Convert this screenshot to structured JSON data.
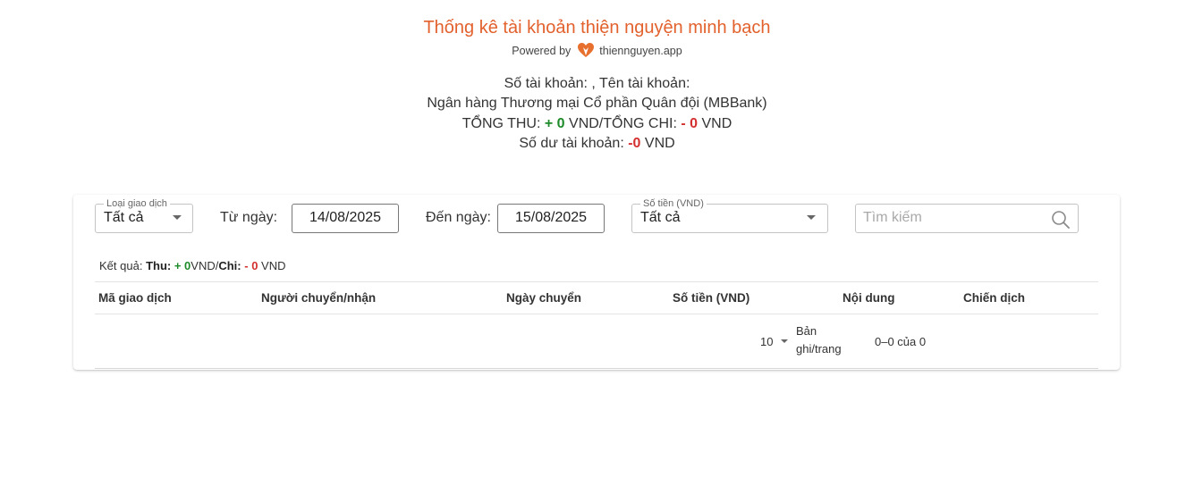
{
  "header": {
    "title": "Thống kê tài khoản thiện nguyện minh bạch",
    "powered_by": "Powered by",
    "brand": "thiennguyen.app",
    "account_line": "Số tài khoản: , Tên tài khoản:",
    "bank_line": "Ngân hàng Thương mại Cổ phần Quân đội (MBBank)",
    "total_in_label": "TỔNG THU:",
    "total_in_value": "+ 0",
    "total_sep": "VND/TỔNG CHI:",
    "total_out_value": "- 0",
    "total_unit": "VND",
    "balance_label": "Số dư tài khoản:",
    "balance_value": "-0",
    "balance_unit": "VND"
  },
  "filters": {
    "type_label": "Loại giao dịch",
    "type_value": "Tất cả",
    "from_label": "Từ ngày:",
    "from_value": "14/08/2025",
    "to_label": "Đến ngày:",
    "to_value": "15/08/2025",
    "amount_label": "Số tiền (VND)",
    "amount_value": "Tất cả",
    "search_placeholder": "Tìm kiếm"
  },
  "result": {
    "prefix": "Kết quả:",
    "in_label": "Thu:",
    "in_value": "+ 0",
    "sep": "VND/",
    "out_label": "Chi:",
    "out_value": "- 0",
    "unit": "VND"
  },
  "table": {
    "columns": [
      "Mã giao dịch",
      "Người chuyển/nhận",
      "Ngày chuyển",
      "Số tiền (VND)",
      "Nội dung",
      "Chiến dịch"
    ],
    "rows": []
  },
  "pagination": {
    "rows_per_page": "10",
    "rows_label_line1": "Bản",
    "rows_label_line2": "ghi/trang",
    "range": "0–0 của 0"
  },
  "colors": {
    "title": "#e2612d",
    "positive": "#1e8b2a",
    "negative": "#d3302f"
  }
}
